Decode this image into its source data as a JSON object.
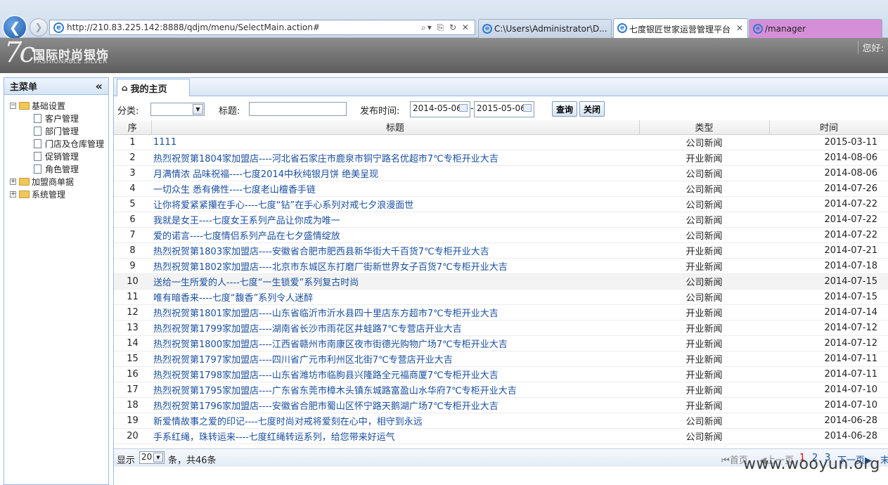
{
  "browser": {
    "url": "http://210.83.225.142:8888/qdjm/menu/SelectMain.action#",
    "tabs": [
      {
        "label": "C:\\Users\\Administrator\\D..."
      },
      {
        "label": "七度银匠世家运营管理平台"
      },
      {
        "label": "/manager"
      }
    ]
  },
  "header": {
    "logo_mark": "7c",
    "logo_cn": "国际时尚银饰",
    "logo_en": "FASHIONABLE SILVER",
    "greeting": "您好:"
  },
  "sidebar": {
    "title": "主菜单",
    "groups": [
      {
        "label": "基础设置",
        "expanded": true,
        "items": [
          "客户管理",
          "部门管理",
          "门店及仓库管理",
          "促销管理",
          "角色管理"
        ]
      },
      {
        "label": "加盟商单据",
        "expanded": false,
        "items": []
      },
      {
        "label": "系统管理",
        "expanded": false,
        "items": []
      }
    ]
  },
  "main": {
    "tab_label": "我的主页",
    "filter": {
      "category_label": "分类:",
      "category_value": "",
      "title_label": "标题:",
      "title_value": "",
      "date_label": "发布时间:",
      "date_from": "2014-05-06",
      "date_sep": "-",
      "date_to": "2015-05-06",
      "query_btn": "查询",
      "close_btn": "关闭"
    },
    "table": {
      "headers": [
        "序",
        "标题",
        "类型",
        "时间"
      ],
      "rows": [
        [
          "1",
          "1111",
          "公司新闻",
          "2015-03-11"
        ],
        [
          "2",
          "热烈祝贺第1804家加盟店----河北省石家庄市鹿泉市铜宁路名优超市7℃专柜开业大吉",
          "开业新闻",
          "2014-08-06"
        ],
        [
          "3",
          "月满情浓 品味祝福----七度2014中秋纯银月饼 绝美呈现",
          "公司新闻",
          "2014-08-06"
        ],
        [
          "4",
          "一切众生 悉有佛性----七度老山檀香手链",
          "公司新闻",
          "2014-07-26"
        ],
        [
          "5",
          "让你将爱紧紧攥在手心----七度“钻”在手心系列对戒七夕浪漫面世",
          "公司新闻",
          "2014-07-22"
        ],
        [
          "6",
          "我就是女王----七度女王系列产品让你成为唯一",
          "公司新闻",
          "2014-07-22"
        ],
        [
          "7",
          "爱的诺言----七度情侣系列产品在七夕盛情绽放",
          "公司新闻",
          "2014-07-22"
        ],
        [
          "8",
          "热烈祝贺第1803家加盟店----安徽省合肥市肥西县新华街大千百货7℃专柜开业大吉",
          "开业新闻",
          "2014-07-21"
        ],
        [
          "9",
          "热烈祝贺第1802家加盟店----北京市东城区东打磨厂街新世界女子百货7℃专柜开业大吉",
          "开业新闻",
          "2014-07-18"
        ],
        [
          "10",
          "送给一生所爱的人----七度“一生锁爱”系列复古时尚",
          "公司新闻",
          "2014-07-15"
        ],
        [
          "11",
          "唯有暗香来----七度“馥香”系列令人迷醉",
          "公司新闻",
          "2014-07-15"
        ],
        [
          "12",
          "热烈祝贺第1801家加盟店----山东省临沂市沂水县四十里店东方超市7℃专柜开业大吉",
          "开业新闻",
          "2014-07-14"
        ],
        [
          "13",
          "热烈祝贺第1799家加盟店----湖南省长沙市雨花区井蛙路7℃专营店开业大吉",
          "开业新闻",
          "2014-07-12"
        ],
        [
          "14",
          "热烈祝贺第1800家加盟店----江西省赣州市南康区夜市街德光购物广场7℃专柜开业大吉",
          "开业新闻",
          "2014-07-12"
        ],
        [
          "15",
          "热烈祝贺第1797家加盟店----四川省广元市利州区北街7℃专营店开业大吉",
          "开业新闻",
          "2014-07-11"
        ],
        [
          "16",
          "热烈祝贺第1798家加盟店----山东省潍坊市临朐县兴隆路全元福商厦7℃专柜开业大吉",
          "开业新闻",
          "2014-07-11"
        ],
        [
          "17",
          "热烈祝贺第1795家加盟店----广东省东莞市樟木头镇东城路富盈山水华府7℃专柜开业大吉",
          "开业新闻",
          "2014-07-10"
        ],
        [
          "18",
          "热烈祝贺第1796家加盟店----安徽省合肥市蜀山区怀宁路天鹅湖广场7℃专柜开业大吉",
          "开业新闻",
          "2014-07-10"
        ],
        [
          "19",
          "新爱情故事之爱的印记----七度时尚对戒将爱刻在心中，相守到永远",
          "公司新闻",
          "2014-06-28"
        ],
        [
          "20",
          "手系红绳，珠转运来----七度红绳转运系列，给您带来好运气",
          "公司新闻",
          "2014-06-28"
        ]
      ]
    },
    "pager": {
      "show_label": "显示",
      "page_size": "20",
      "total_label": "条，共46条",
      "first": "首页",
      "prev": "上一页",
      "pages": [
        "1",
        "2",
        "3"
      ],
      "next": "下一页",
      "last": "末"
    }
  },
  "watermark": "www.wooyun.org"
}
